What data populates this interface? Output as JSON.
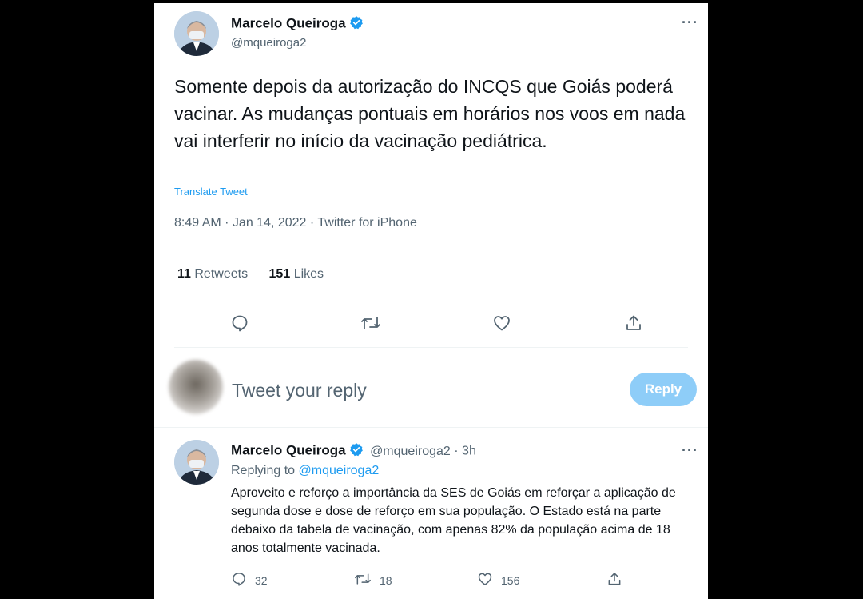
{
  "tweet": {
    "author_name": "Marcelo Queiroga",
    "author_handle": "@mqueiroga2",
    "text": "Somente depois da autorização do INCQS que Goiás poderá vacinar. As mudanças pontuais em horários nos voos em nada vai interferir no início da vacinação pediátrica.",
    "translate_label": "Translate Tweet",
    "timestamp": "8:49 AM · Jan 14, 2022 · Twitter for iPhone",
    "retweets_count": "11",
    "retweets_label": "Retweets",
    "likes_count": "151",
    "likes_label": "Likes",
    "more_label": "···"
  },
  "composer": {
    "placeholder": "Tweet your reply",
    "reply_button": "Reply"
  },
  "reply": {
    "author_name": "Marcelo Queiroga",
    "author_handle": "@mqueiroga2",
    "age": "· 3h",
    "replying_prefix": "Replying to",
    "replying_to": "@mqueiroga2",
    "text": "Aproveito e reforço a importância da SES de Goiás em reforçar a aplicação de segunda dose e dose de reforço em sua população. O Estado está na parte debaixo da tabela de vacinação, com apenas 82% da população acima de 18 anos totalmente vacinada.",
    "reply_count": "32",
    "retweet_count": "18",
    "like_count": "156",
    "more_label": "···"
  },
  "colors": {
    "accent": "#1d9bf0",
    "reply_button_bg": "#8ecdf8",
    "secondary_text": "#536471"
  },
  "icons": [
    "verified-badge-icon",
    "more-icon",
    "reply-icon",
    "retweet-icon",
    "like-icon",
    "share-icon"
  ]
}
